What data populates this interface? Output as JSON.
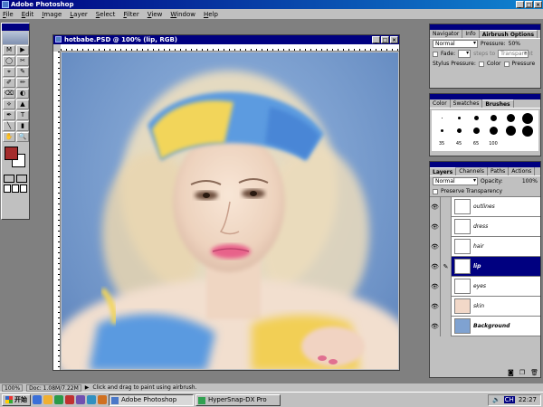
{
  "app": {
    "title": "Adobe Photoshop"
  },
  "menu": [
    "File",
    "Edit",
    "Image",
    "Layer",
    "Select",
    "Filter",
    "View",
    "Window",
    "Help"
  ],
  "document": {
    "title": "hotbabe.PSD @ 100% (lip, RGB)"
  },
  "tools": [
    "M",
    "▶",
    "◯",
    "✂",
    "⌖",
    "✎",
    "✐",
    "✏",
    "⌫",
    "◐",
    "⟡",
    "▲",
    "✒",
    "T",
    "╲",
    "▮",
    "✋",
    "🔍"
  ],
  "colors": {
    "foreground": "#a42c2c",
    "background": "#ffffff",
    "title_bar": "#000080",
    "selection": "#000080"
  },
  "options_palette": {
    "tabs": [
      "Navigator",
      "Info",
      "Airbrush Options"
    ],
    "active_tab": "Airbrush Options",
    "mode": "Normal",
    "pressure_label": "Pressure:",
    "pressure": "50%",
    "fade_label": "Fade:",
    "steps_label": "steps to",
    "transparent": "Transparent",
    "stylus_label": "Stylus Pressure:",
    "color_label": "Color",
    "pressure_check_label": "Pressure"
  },
  "brushes_palette": {
    "tabs": [
      "Color",
      "Swatches",
      "Brushes"
    ],
    "active_tab": "Brushes",
    "labels": [
      "35",
      "45",
      "65",
      "100"
    ]
  },
  "layers_palette": {
    "tabs": [
      "Layers",
      "Channels",
      "Paths",
      "Actions"
    ],
    "active_tab": "Layers",
    "mode": "Normal",
    "opacity_label": "Opacity:",
    "opacity": "100%",
    "preserve_label": "Preserve Transparency",
    "layers": [
      {
        "name": "outlines"
      },
      {
        "name": "dress"
      },
      {
        "name": "hair"
      },
      {
        "name": "lip",
        "selected": true
      },
      {
        "name": "eyes"
      },
      {
        "name": "skin"
      },
      {
        "name": "Background"
      }
    ]
  },
  "status": {
    "zoom": "100%",
    "doc": "Doc: 1.08M/7.22M",
    "hint": "Click and drag to paint using airbrush."
  },
  "taskbar": {
    "start": "开始",
    "tasks": [
      {
        "label": "Adobe Photoshop",
        "active": true
      },
      {
        "label": "HyperSnap-DX Pro",
        "active": false
      }
    ],
    "tray_lang": "CH",
    "clock": "22:27"
  }
}
